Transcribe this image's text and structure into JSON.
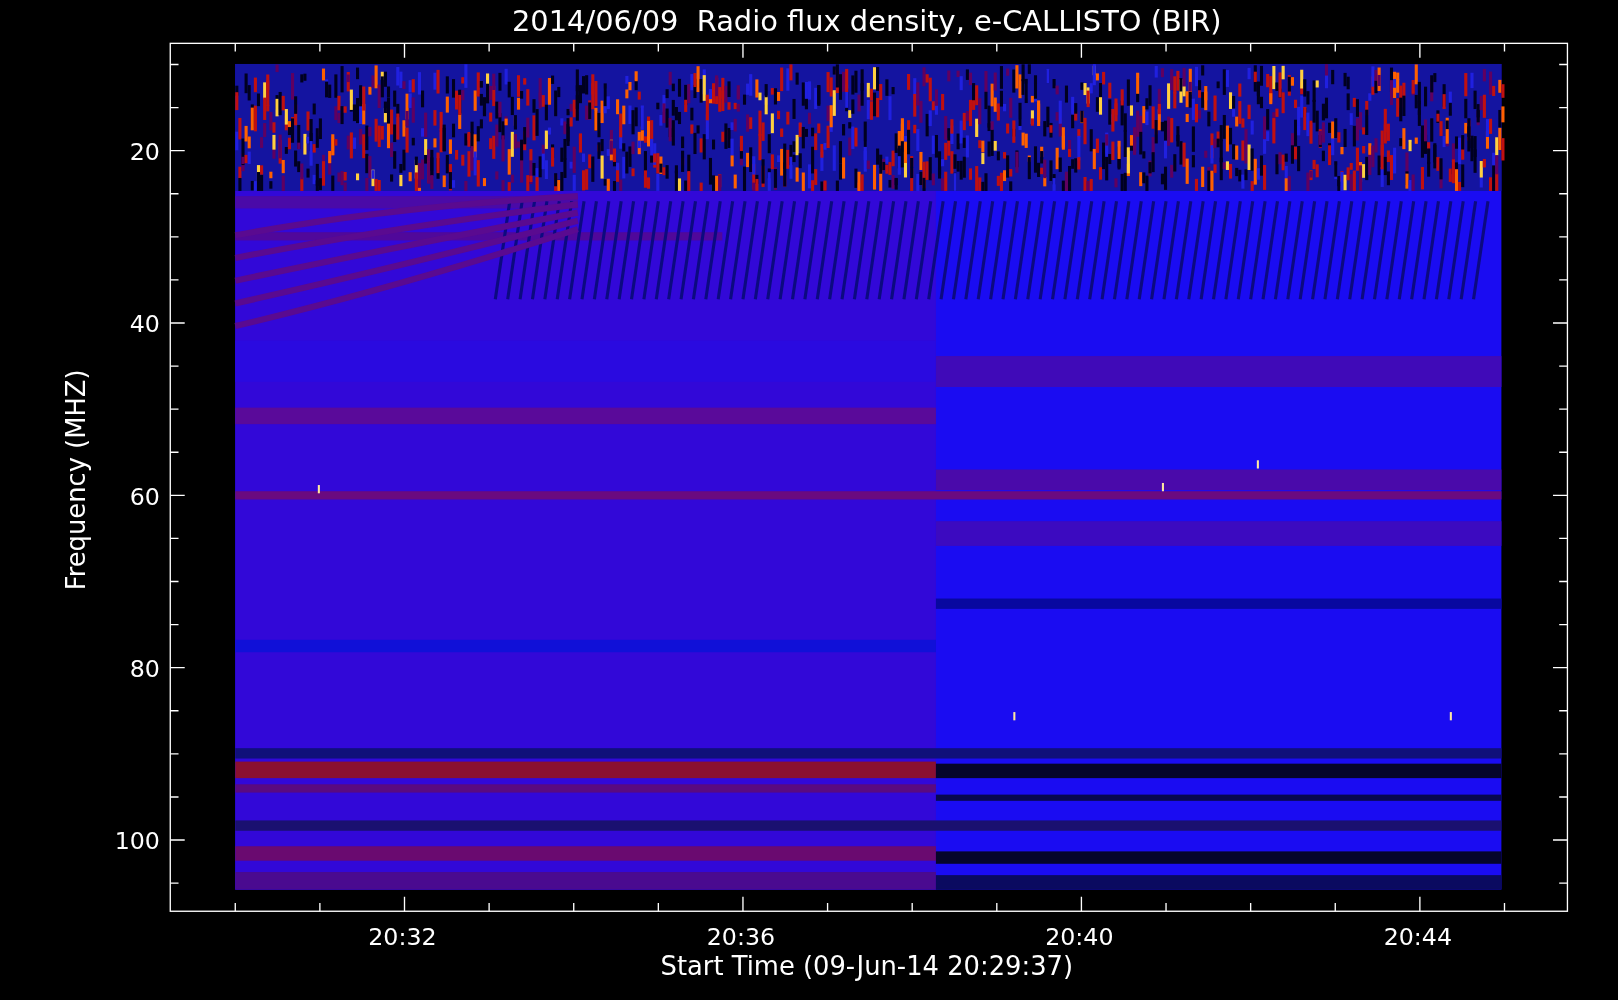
{
  "title": "2014/06/09  Radio flux density, e-CALLISTO (BIR)",
  "y_axis": {
    "label": "Frequency (MHZ)",
    "ticks": [
      "20",
      "40",
      "60",
      "80",
      "100"
    ]
  },
  "x_axis": {
    "label": "Start Time (09-Jun-14 20:29:37)",
    "ticks": [
      "20:32",
      "20:36",
      "20:40",
      "20:44"
    ]
  }
}
